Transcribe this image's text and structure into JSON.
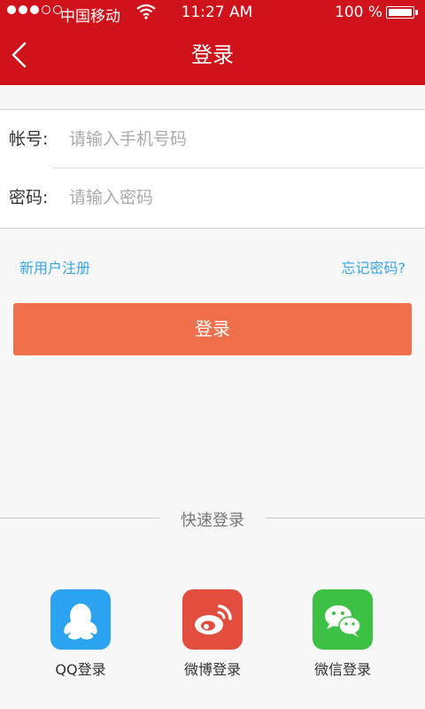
{
  "status_bar": {
    "carrier": "中国移动",
    "time": "11:27 AM",
    "battery": "100 %"
  },
  "header": {
    "title": "登录"
  },
  "form": {
    "account_label": "帐号:",
    "account_placeholder": "请输入手机号码",
    "password_label": "密码:",
    "password_placeholder": "请输入密码"
  },
  "links": {
    "register": "新用户注册",
    "forgot": "忘记密码?"
  },
  "login_button": "登录",
  "quick_login": {
    "title": "快速登录",
    "items": [
      {
        "label": "QQ登录",
        "icon": "qq-icon",
        "color": "#2ba3f0"
      },
      {
        "label": "微博登录",
        "icon": "weibo-icon",
        "color": "#e34d3e"
      },
      {
        "label": "微信登录",
        "icon": "wechat-icon",
        "color": "#3cc145"
      }
    ]
  },
  "colors": {
    "header": "#d0121b",
    "link": "#3aa6e6",
    "button": "#f0704c"
  }
}
